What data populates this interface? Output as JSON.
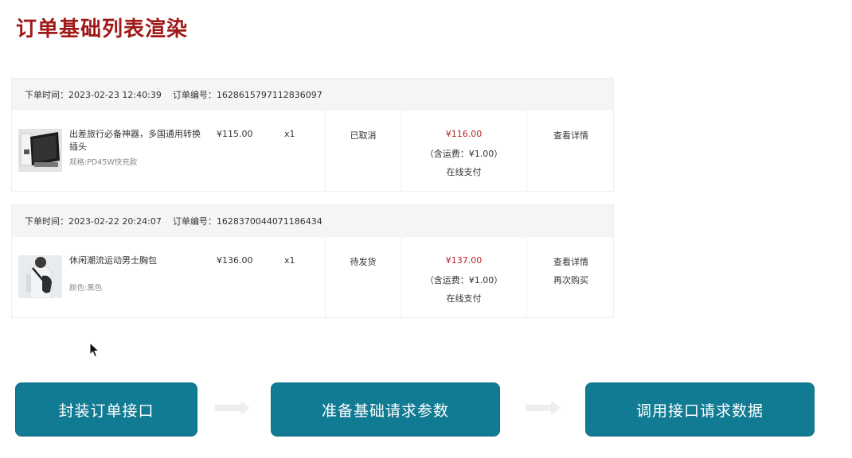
{
  "page_title": "订单基础列表渲染",
  "orders": [
    {
      "time_label": "下单时间：",
      "time_value": "2023-02-23 12:40:39",
      "no_label": "订单编号：",
      "no_value": "1628615797112836097",
      "goods_name": "出差旅行必备神器，多国通用转换插头",
      "goods_spec": "规格:PD45W快充款",
      "price": "¥115.00",
      "quantity": "x1",
      "status": "已取消",
      "total": "¥116.00",
      "shipping": "（含运费：¥1.00）",
      "pay_type": "在线支付",
      "actions": [
        "查看详情"
      ]
    },
    {
      "time_label": "下单时间：",
      "time_value": "2023-02-22 20:24:07",
      "no_label": "订单编号：",
      "no_value": "1628370044071186434",
      "goods_name": "休闲潮流运动男士胸包",
      "goods_spec": "颜色:黑色",
      "price": "¥136.00",
      "quantity": "x1",
      "status": "待发货",
      "total": "¥137.00",
      "shipping": "（含运费：¥1.00）",
      "pay_type": "在线支付",
      "actions": [
        "查看详情",
        "再次购买"
      ]
    }
  ],
  "flow_steps": [
    "封装订单接口",
    "准备基础请求参数",
    "调用接口请求数据"
  ],
  "colors": {
    "title": "#a01919",
    "price_red": "#b0242b",
    "flow_button": "#117b94",
    "header_bg": "#f5f5f5"
  },
  "icons": [
    "travel-adapter-product-image",
    "chest-bag-product-image",
    "arrow-right-icon",
    "mouse-cursor-icon"
  ]
}
